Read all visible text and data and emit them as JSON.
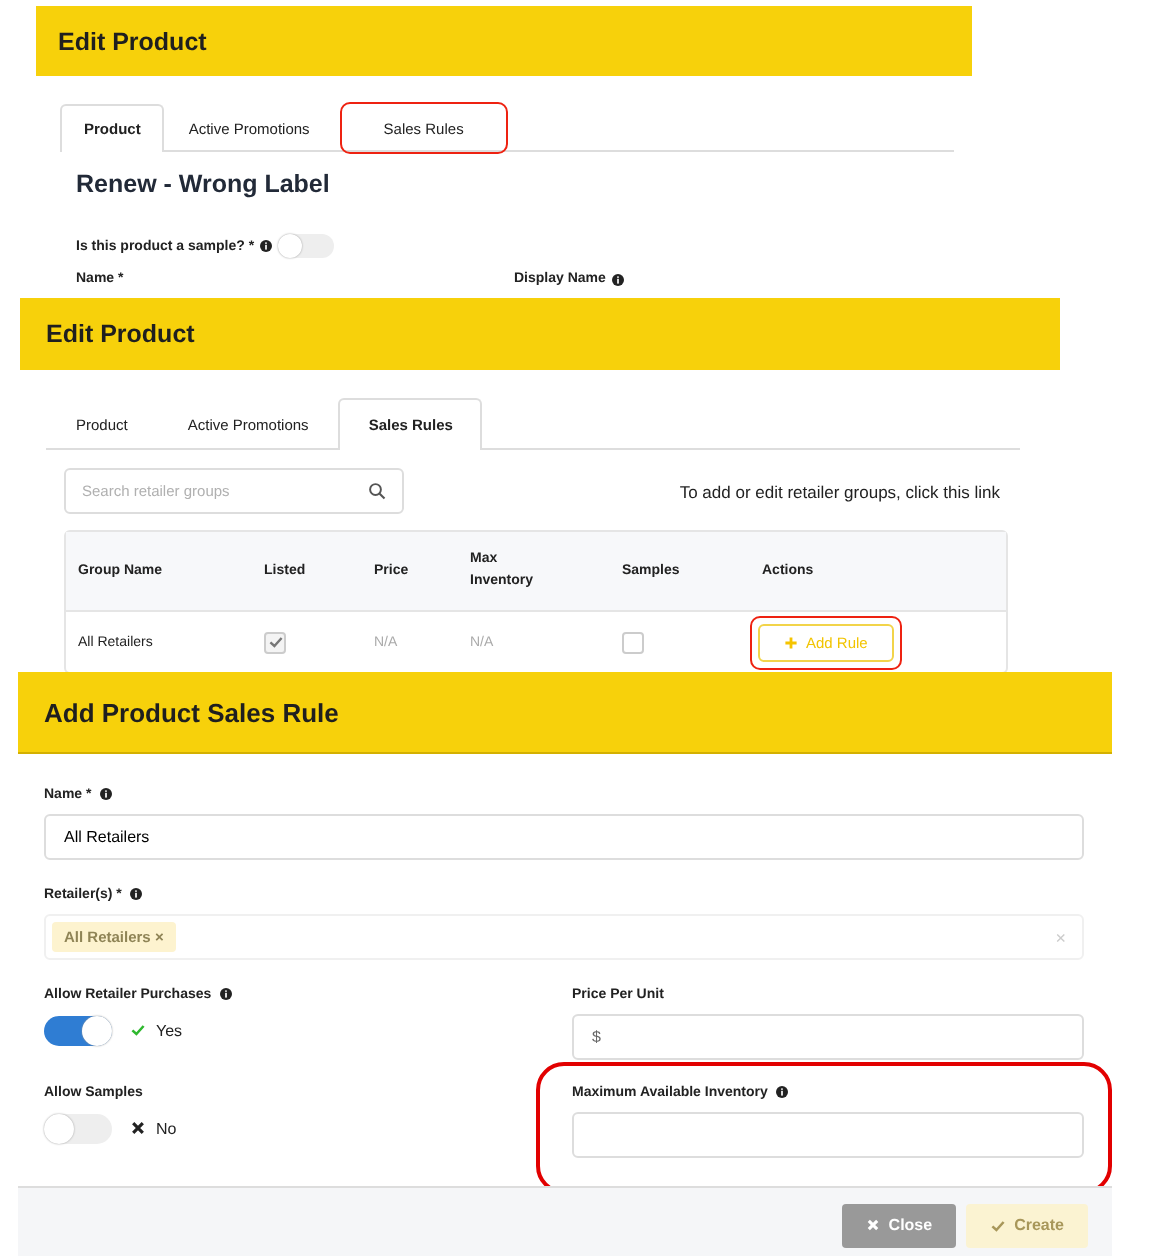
{
  "product_panel": {
    "title": "Edit Product",
    "tabs": [
      {
        "label": "Product",
        "selected": true,
        "highlighted": false
      },
      {
        "label": "Active Promotions",
        "selected": false,
        "highlighted": false
      },
      {
        "label": "Sales Rules",
        "selected": false,
        "highlighted": true
      }
    ],
    "product_name": "Renew - Wrong Label",
    "sample_question": "Is this product a sample? *",
    "sample_on": false,
    "fields": [
      {
        "label": "Name *",
        "info": false
      },
      {
        "label": "Display Name",
        "info": true
      }
    ]
  },
  "sales_rules_panel": {
    "title": "Edit Product",
    "tabs": [
      {
        "label": "Product",
        "selected": false
      },
      {
        "label": "Active Promotions",
        "selected": false
      },
      {
        "label": "Sales Rules",
        "selected": true
      }
    ],
    "search": {
      "placeholder": "Search retailer groups"
    },
    "link_hint": "To add or edit retailer groups, click this link",
    "columns": [
      "Group Name",
      "Listed",
      "Price",
      "Max Inventory",
      "Samples",
      "Actions"
    ],
    "rows": [
      {
        "group": "All Retailers",
        "listed": true,
        "price": "N/A",
        "max_inventory": "N/A",
        "samples": false,
        "action": "Add Rule",
        "action_highlighted": true
      }
    ]
  },
  "rule_dialog": {
    "title": "Add Product Sales Rule",
    "name": {
      "label": "Name *",
      "value": "All Retailers"
    },
    "retailers": {
      "label": "Retailer(s) *",
      "tags": [
        "All Retailers"
      ],
      "clear": "×",
      "tag_remove": "×"
    },
    "purchases": {
      "label": "Allow Retailer Purchases",
      "on": true,
      "state": "Yes"
    },
    "price": {
      "label": "Price Per Unit",
      "prefix": "$"
    },
    "samples": {
      "label": "Allow Samples",
      "on": false,
      "state": "No"
    },
    "max_inventory": {
      "label": "Maximum Available Inventory",
      "highlighted": true
    },
    "buttons": [
      {
        "label": "Close",
        "kind": "close",
        "disabled": false
      },
      {
        "label": "Create",
        "kind": "create",
        "disabled": true
      }
    ]
  }
}
